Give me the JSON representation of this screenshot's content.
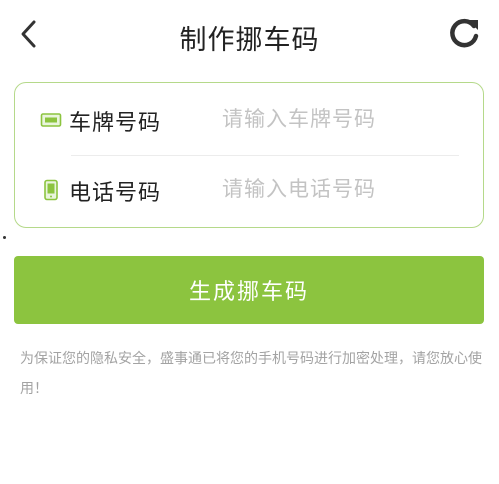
{
  "header": {
    "title": "制作挪车码",
    "back_icon": "chevron-left-icon",
    "refresh_icon": "refresh-icon"
  },
  "form": {
    "plate": {
      "icon": "license-plate-icon",
      "label": "车牌号码",
      "value": "",
      "placeholder": "请输入车牌号码"
    },
    "phone": {
      "icon": "mobile-phone-icon",
      "label": "电话号码",
      "value": "",
      "placeholder": "请输入电话号码"
    }
  },
  "submit": {
    "label": "生成挪车码"
  },
  "note": "为保证您的隐私安全，盛事通已将您的手机号码进行加密处理，请您放心使用！",
  "colors": {
    "accent": "#8cc43f",
    "card_border": "#b5d98a",
    "placeholder": "#c3c3c3",
    "note_text": "#a3a3a3"
  }
}
